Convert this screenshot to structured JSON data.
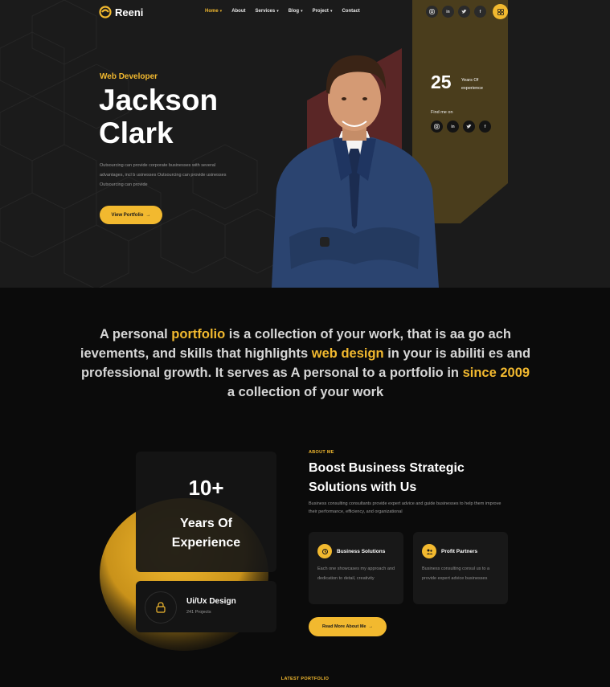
{
  "brand": {
    "name": "Reeni"
  },
  "nav": {
    "items": [
      {
        "label": "Home",
        "active": true,
        "dropdown": true
      },
      {
        "label": "About",
        "active": false,
        "dropdown": false
      },
      {
        "label": "Services",
        "active": false,
        "dropdown": true
      },
      {
        "label": "Blog",
        "active": false,
        "dropdown": true
      },
      {
        "label": "Project",
        "active": false,
        "dropdown": true
      },
      {
        "label": "Contact",
        "active": false,
        "dropdown": false
      }
    ],
    "social": [
      "instagram-icon",
      "linkedin-icon",
      "twitter-icon",
      "facebook-icon"
    ],
    "menu_icon": "grid-menu-icon"
  },
  "hero": {
    "role": "Web Developer",
    "name_line1": "Jackson",
    "name_line2": "Clark",
    "description": "Outsourcing can provide corporate businesses with several advantages, incl b usinesses Outsourcing can provide usinesses Outsourcing can provide",
    "cta_label": "View Portfolio",
    "years_number": "25",
    "years_label": "Years Of experience",
    "find_me": "Find me on",
    "social": [
      "instagram-icon",
      "linkedin-icon",
      "twitter-icon",
      "facebook-icon"
    ]
  },
  "mission": {
    "parts": [
      {
        "text": "A personal ",
        "highlight": false
      },
      {
        "text": "portfolio",
        "highlight": true
      },
      {
        "text": " is a collection of your work, that is aa go ach ievements, and skills that highlights ",
        "highlight": false
      },
      {
        "text": "web design",
        "highlight": true
      },
      {
        "text": " in your is abiliti es and professional growth. It serves as A personal to a portfolio in ",
        "highlight": false
      },
      {
        "text": "since 2009",
        "highlight": true
      },
      {
        "text": " a collection of your work",
        "highlight": false
      }
    ]
  },
  "about": {
    "exp_number": "10+",
    "exp_label_line1": "Years Of",
    "exp_label_line2": "Experience",
    "ux_title": "Ui/Ux Design",
    "ux_sub": "241 Projects",
    "tag": "ABOUT ME",
    "title": "Boost Business Strategic Solutions with Us",
    "description": "Business consulting consultants provide expert advice and guide businesses to help them improve their performance, efficiency, and organizational",
    "features": [
      {
        "title": "Business Solutions",
        "desc": "Each one showcases my approach and dedication to detail, creativity"
      },
      {
        "title": "Profit Partners",
        "desc": "Business consulting consul us to a provide expert advice businesses"
      }
    ],
    "cta_label": "Read More About Me"
  },
  "latest": {
    "tag": "LATEST PORTFOLIO"
  },
  "colors": {
    "accent": "#f2b92f",
    "hero_bg": "#1b1b1b",
    "page_bg": "#0b0b0b",
    "card_bg": "#181818",
    "maroon": "#5a2626",
    "olive": "#4a3d1c"
  }
}
